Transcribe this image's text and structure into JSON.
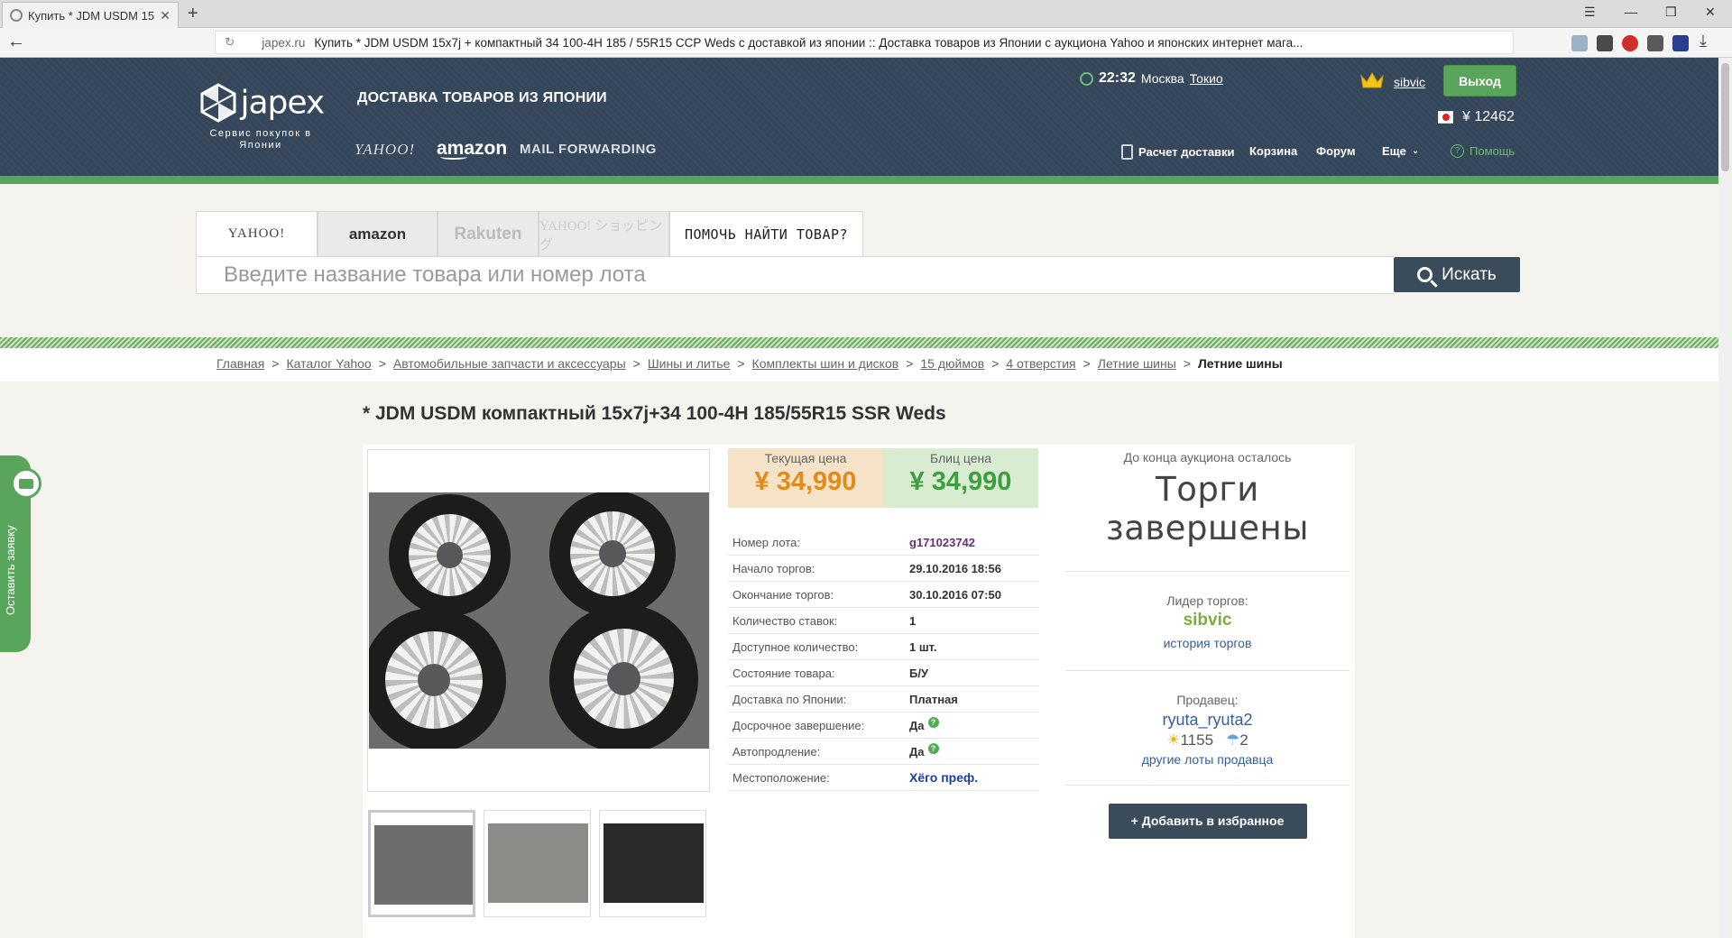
{
  "browser": {
    "tab_title": "Купить * JDM USDM 15",
    "url_host": "japex.ru",
    "url_rest": "Купить * JDM USDM 15x7j + компактный 34 100-4H 185 / 55R15 CCP Weds с доставкой из японии :: Доставка товаров из Японии с аукциона Yahoo и японских интернет мага..."
  },
  "header": {
    "logo_text": "japex",
    "logo_sub": "Сервис покупок в Японии",
    "tagline": "ДОСТАВКА ТОВАРОВ ИЗ ЯПОНИИ",
    "brand_yahoo": "YAHOO!",
    "brand_amazon": "amazon",
    "brand_mail": "MAIL FORWARDING",
    "time": "22:32",
    "city1": "Москва",
    "city2": "Токио",
    "username": "sibvic",
    "logout": "Выход",
    "balance": "¥ 12462",
    "nav": {
      "calc": "Расчет доставки",
      "cart": "Корзина",
      "forum": "Форум",
      "more": "Еще",
      "help": "Помощь"
    }
  },
  "search": {
    "tabs": [
      "YAHOO!",
      "amazon",
      "Rakuten",
      "YAHOO! ショッピング",
      "ПОМОЧЬ НАЙТИ ТОВАР?"
    ],
    "placeholder": "Введите название товара или номер лота",
    "button": "Искать"
  },
  "breadcrumb": [
    "Главная",
    "Каталог Yahoo",
    "Автомобильные запчасти и аксессуары",
    "Шины и литье",
    "Комплекты шин и дисков",
    "15 дюймов",
    "4 отверстия",
    "Летние шины",
    "Летние шины"
  ],
  "product": {
    "title": "* JDM USDM компактный 15x7j+34 100-4H 185/55R15 SSR Weds",
    "current_price_label": "Текущая цена",
    "current_price": "¥ 34,990",
    "blitz_price_label": "Блиц цена",
    "blitz_price": "¥ 34,990",
    "info": [
      {
        "k": "Номер лота:",
        "v": "g171023742"
      },
      {
        "k": "Начало торгов:",
        "v": "29.10.2016 18:56"
      },
      {
        "k": "Окончание торгов:",
        "v": "30.10.2016 07:50"
      },
      {
        "k": "Количество ставок:",
        "v": "1"
      },
      {
        "k": "Доступное количество:",
        "v": "1 шт."
      },
      {
        "k": "Состояние товара:",
        "v": "Б/У"
      },
      {
        "k": "Доставка по Японии:",
        "v": "Платная"
      },
      {
        "k": "Досрочное завершение:",
        "v": "Да"
      },
      {
        "k": "Автопродление:",
        "v": "Да"
      },
      {
        "k": "Местоположение:",
        "v": "Хёго преф."
      }
    ],
    "time_left_label": "До конца аукциона осталось",
    "status": "Торги завершены",
    "leader_label": "Лидер торгов:",
    "leader": "sibvic",
    "history_link": "история торгов",
    "seller_label": "Продавец:",
    "seller": "ryuta_ryuta2",
    "rating_pos": "1155",
    "rating_neg": "2",
    "seller_lots": "другие лоты продавца",
    "favorite": "+ Добавить в избранное"
  },
  "side": {
    "label": "Оставить заявку"
  }
}
